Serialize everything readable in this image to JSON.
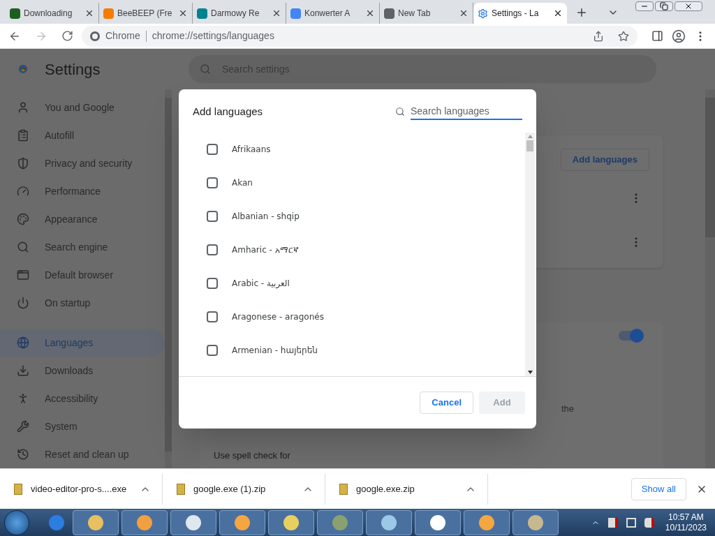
{
  "browser": {
    "tabs": [
      {
        "title": "Downloading",
        "selected": false
      },
      {
        "title": "BeeBEEP (Fre",
        "selected": false
      },
      {
        "title": "Darmowy Re",
        "selected": false
      },
      {
        "title": "Konwerter A",
        "selected": false
      },
      {
        "title": "New Tab",
        "selected": false
      },
      {
        "title": "Settings - La",
        "selected": true
      }
    ],
    "site_label": "Chrome",
    "url": "chrome://settings/languages"
  },
  "settings": {
    "title": "Settings",
    "search_placeholder": "Search settings",
    "nav": [
      {
        "label": "You and Google",
        "selected": false
      },
      {
        "label": "Autofill",
        "selected": false
      },
      {
        "label": "Privacy and security",
        "selected": false
      },
      {
        "label": "Performance",
        "selected": false
      },
      {
        "label": "Appearance",
        "selected": false
      },
      {
        "label": "Search engine",
        "selected": false
      },
      {
        "label": "Default browser",
        "selected": false
      },
      {
        "label": "On startup",
        "selected": false
      },
      {
        "label": "Languages",
        "selected": true
      },
      {
        "label": "Downloads",
        "selected": false
      },
      {
        "label": "Accessibility",
        "selected": false
      },
      {
        "label": "System",
        "selected": false
      },
      {
        "label": "Reset and clean up",
        "selected": false
      }
    ],
    "add_languages_button": "Add languages",
    "spell_toggle_on": true,
    "text_fragment": "the",
    "spell_label": "Use spell check for"
  },
  "dialog": {
    "title": "Add languages",
    "search_placeholder": "Search languages",
    "languages": [
      {
        "name": "Afrikaans",
        "checked": false
      },
      {
        "name": "Akan",
        "checked": false
      },
      {
        "name": "Albanian - shqip",
        "checked": false
      },
      {
        "name": "Amharic - አማርኛ",
        "checked": false
      },
      {
        "name": "Arabic - العربية",
        "checked": false
      },
      {
        "name": "Aragonese - aragonés",
        "checked": false
      },
      {
        "name": "Armenian - հայերեն",
        "checked": false
      }
    ],
    "cancel": "Cancel",
    "add": "Add",
    "add_disabled": true
  },
  "downloads": {
    "items": [
      {
        "name": "video-editor-pro-s....exe"
      },
      {
        "name": "google.exe (1).zip"
      },
      {
        "name": "google.exe.zip"
      }
    ],
    "show_all": "Show all"
  },
  "taskbar": {
    "time": "10:57 AM",
    "date": "10/11/2023"
  }
}
